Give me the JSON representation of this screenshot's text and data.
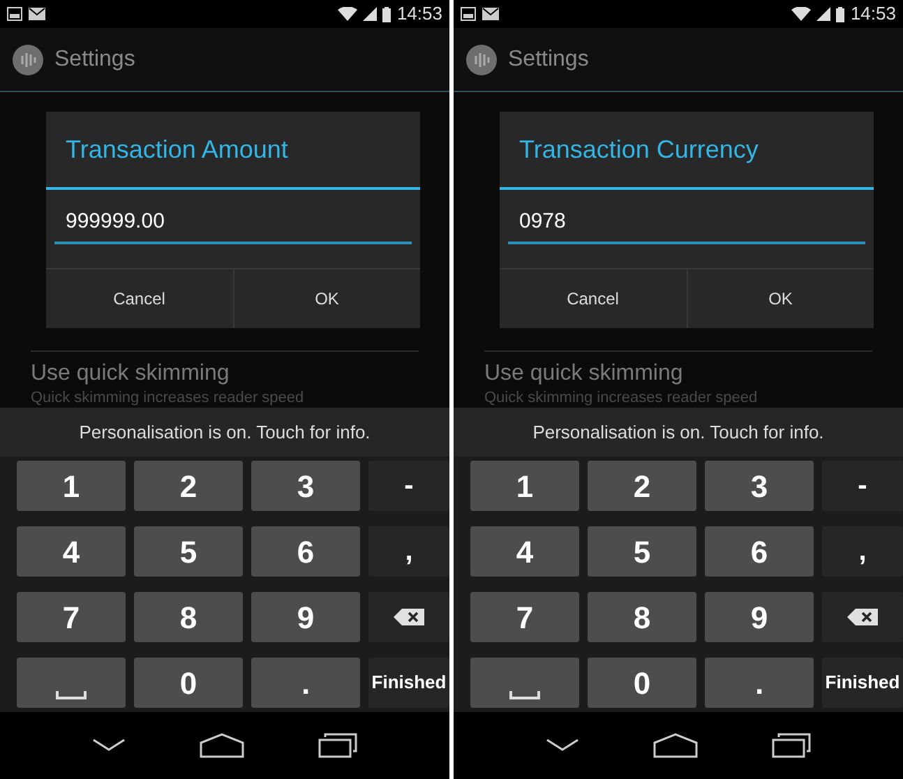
{
  "phones": [
    {
      "status_bar": {
        "time": "14:53"
      },
      "action_bar": {
        "title": "Settings"
      },
      "settings_list": [
        {
          "title": "Use quick skimming",
          "summary": "Quick skimming increases reader speed"
        }
      ],
      "dialog": {
        "title": "Transaction Amount",
        "value": "999999.00",
        "buttons": [
          "Cancel",
          "OK"
        ]
      },
      "keyboard": {
        "suggestion": "Personalisation is on. Touch for info.",
        "keys": [
          {
            "kind": "digit",
            "label": "1"
          },
          {
            "kind": "digit",
            "label": "2"
          },
          {
            "kind": "digit",
            "label": "3"
          },
          {
            "kind": "symbol",
            "label": "-"
          },
          {
            "kind": "digit",
            "label": "4"
          },
          {
            "kind": "digit",
            "label": "5"
          },
          {
            "kind": "digit",
            "label": "6"
          },
          {
            "kind": "symbol",
            "label": ","
          },
          {
            "kind": "digit",
            "label": "7"
          },
          {
            "kind": "digit",
            "label": "8"
          },
          {
            "kind": "digit",
            "label": "9"
          },
          {
            "kind": "backspace"
          },
          {
            "kind": "space"
          },
          {
            "kind": "digit",
            "label": "0"
          },
          {
            "kind": "digit",
            "label": "."
          },
          {
            "kind": "action",
            "label": "Finished"
          }
        ]
      }
    },
    {
      "status_bar": {
        "time": "14:53"
      },
      "action_bar": {
        "title": "Settings"
      },
      "settings_list": [
        {
          "title": "Use quick skimming",
          "summary": "Quick skimming increases reader speed"
        }
      ],
      "dialog": {
        "title": "Transaction Currency",
        "value": "0978",
        "buttons": [
          "Cancel",
          "OK"
        ]
      },
      "keyboard": {
        "suggestion": "Personalisation is on. Touch for info.",
        "keys": [
          {
            "kind": "digit",
            "label": "1"
          },
          {
            "kind": "digit",
            "label": "2"
          },
          {
            "kind": "digit",
            "label": "3"
          },
          {
            "kind": "symbol",
            "label": "-"
          },
          {
            "kind": "digit",
            "label": "4"
          },
          {
            "kind": "digit",
            "label": "5"
          },
          {
            "kind": "digit",
            "label": "6"
          },
          {
            "kind": "symbol",
            "label": ","
          },
          {
            "kind": "digit",
            "label": "7"
          },
          {
            "kind": "digit",
            "label": "8"
          },
          {
            "kind": "digit",
            "label": "9"
          },
          {
            "kind": "backspace"
          },
          {
            "kind": "space"
          },
          {
            "kind": "digit",
            "label": "0"
          },
          {
            "kind": "digit",
            "label": "."
          },
          {
            "kind": "action",
            "label": "Finished"
          }
        ]
      }
    }
  ]
}
